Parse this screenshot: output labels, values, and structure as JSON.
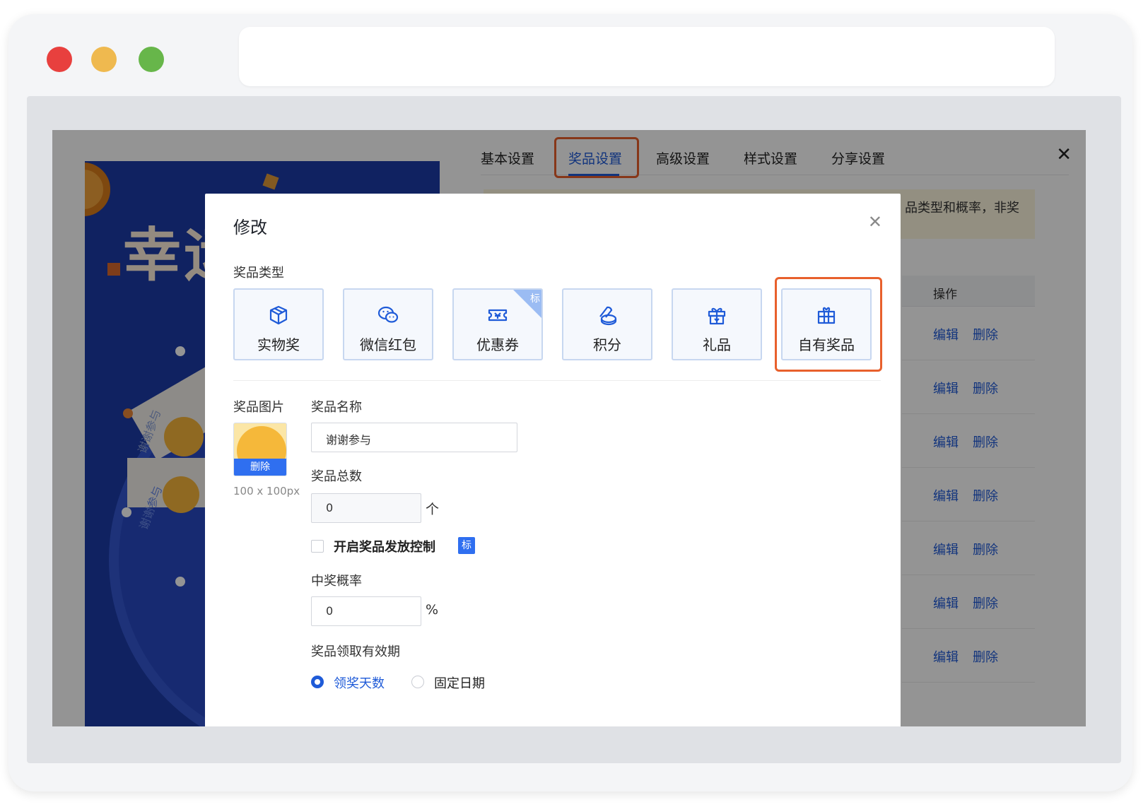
{
  "settings": {
    "tabs": [
      "基本设置",
      "奖品设置",
      "高级设置",
      "样式设置",
      "分享设置"
    ],
    "active_tab": "奖品设置",
    "notice": "品类型和概率，非奖",
    "table_header_action": "操作",
    "row_edit": "编辑",
    "row_delete": "删除",
    "row_count": 7
  },
  "preview": {
    "title": "幸运",
    "wheel_label": "谢谢参与"
  },
  "modal": {
    "title": "修改",
    "prize_type_label": "奖品类型",
    "prize_types": [
      {
        "label": "实物奖",
        "icon": "box-icon"
      },
      {
        "label": "微信红包",
        "icon": "wechat-icon"
      },
      {
        "label": "优惠券",
        "icon": "coupon-icon",
        "tag": "标"
      },
      {
        "label": "积分",
        "icon": "coins-icon"
      },
      {
        "label": "礼品",
        "icon": "gift-box-icon"
      },
      {
        "label": "自有奖品",
        "icon": "gift-icon"
      }
    ],
    "image_label": "奖品图片",
    "image_delete": "删除",
    "image_hint": "100 x 100px",
    "name_label": "奖品名称",
    "name_value": "谢谢参与",
    "total_label": "奖品总数",
    "total_value": "0",
    "total_unit": "个",
    "control_label": "开启奖品发放控制",
    "control_badge": "标",
    "probability_label": "中奖概率",
    "probability_value": "0",
    "probability_unit": "%",
    "validity_label": "奖品领取有效期",
    "validity_options": [
      "领奖天数",
      "固定日期"
    ],
    "validity_selected": "领奖天数"
  },
  "colors": {
    "accent": "#1f5bd8",
    "highlight": "#e8602c",
    "card_border": "#c7d7f0"
  }
}
